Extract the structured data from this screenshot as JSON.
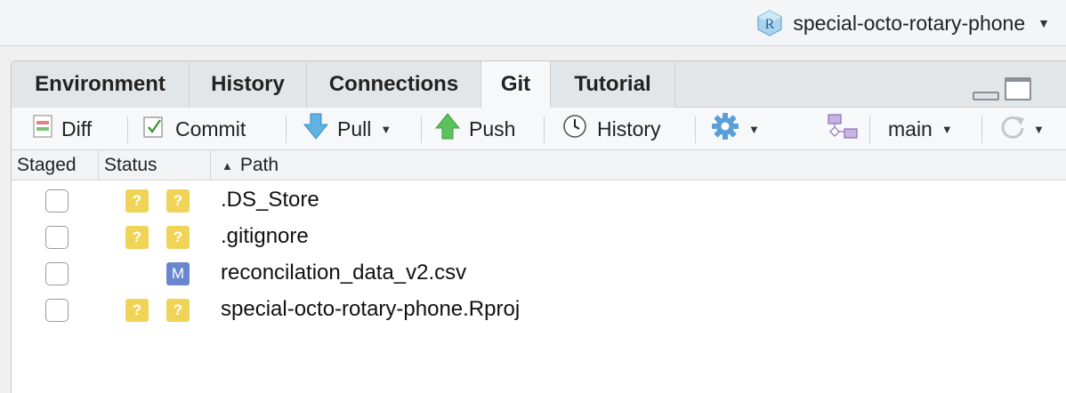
{
  "project": {
    "name": "special-octo-rotary-phone",
    "icon": "rproject-icon"
  },
  "tabs": [
    {
      "label": "Environment",
      "active": false
    },
    {
      "label": "History",
      "active": false
    },
    {
      "label": "Connections",
      "active": false
    },
    {
      "label": "Git",
      "active": true
    },
    {
      "label": "Tutorial",
      "active": false
    }
  ],
  "toolbar": {
    "diff": "Diff",
    "commit": "Commit",
    "pull": "Pull",
    "push": "Push",
    "history": "History",
    "branch": "main"
  },
  "columns": {
    "staged": "Staged",
    "status": "Status",
    "path": "Path"
  },
  "files": [
    {
      "path": ".DS_Store",
      "staged": false,
      "status": [
        "?",
        "?"
      ]
    },
    {
      "path": ".gitignore",
      "staged": false,
      "status": [
        "?",
        "?"
      ]
    },
    {
      "path": "reconcilation_data_v2.csv",
      "staged": false,
      "status": [
        "",
        "M"
      ]
    },
    {
      "path": "special-octo-rotary-phone.Rproj",
      "staged": false,
      "status": [
        "?",
        "?"
      ]
    }
  ],
  "colors": {
    "untracked_badge": "#f0d458",
    "modified_badge": "#6a86cf"
  }
}
